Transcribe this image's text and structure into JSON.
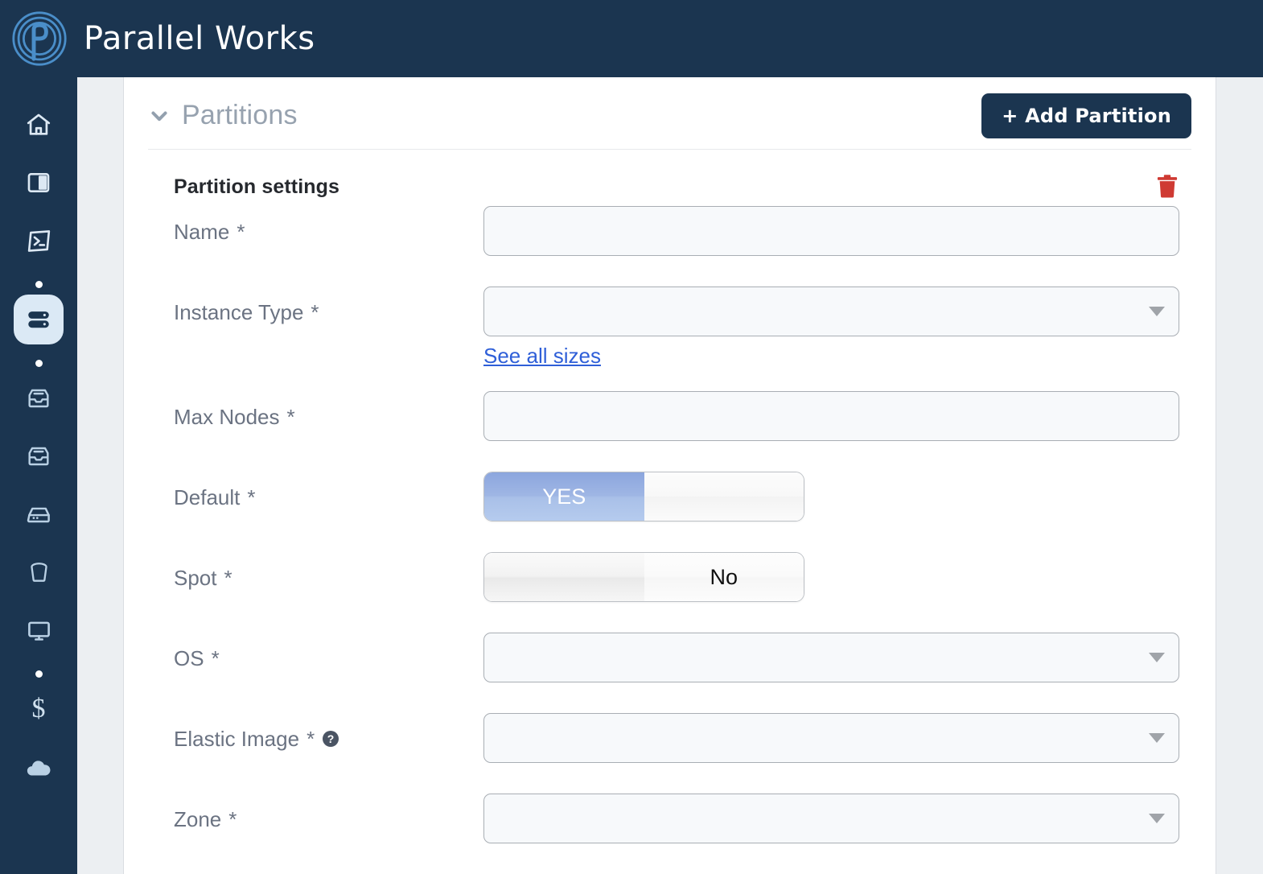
{
  "topbar": {
    "brand_name": "Parallel Works",
    "logo_icon": "parallel-works-logo",
    "bg_color": "#1b3550"
  },
  "sidebar": {
    "items": [
      {
        "icon": "home-icon",
        "name": "home",
        "type": "icon",
        "active": false
      },
      {
        "icon": "panel-icon",
        "name": "panel",
        "type": "icon",
        "active": false
      },
      {
        "icon": "terminal-icon",
        "name": "terminal",
        "type": "icon",
        "active": false
      },
      {
        "icon": "dot-icon",
        "name": "divider-1",
        "type": "dot",
        "active": false
      },
      {
        "icon": "server-icon",
        "name": "clusters",
        "type": "icon",
        "active": true
      },
      {
        "icon": "dot-icon",
        "name": "divider-2",
        "type": "dot",
        "active": false
      },
      {
        "icon": "inbox-icon",
        "name": "inbox-1",
        "type": "icon",
        "active": false
      },
      {
        "icon": "inbox-icon",
        "name": "inbox-2",
        "type": "icon",
        "active": false
      },
      {
        "icon": "harddrive-icon",
        "name": "storage",
        "type": "icon",
        "active": false
      },
      {
        "icon": "bucket-icon",
        "name": "buckets",
        "type": "icon",
        "active": false
      },
      {
        "icon": "monitor-icon",
        "name": "sessions",
        "type": "icon",
        "active": false
      },
      {
        "icon": "dot-icon",
        "name": "divider-3",
        "type": "dot",
        "active": false
      },
      {
        "icon": "dollar-icon",
        "name": "billing",
        "type": "money",
        "active": false,
        "glyph": "$"
      },
      {
        "icon": "cloud-icon",
        "name": "cloud",
        "type": "icon",
        "active": false
      }
    ],
    "active_bg": "#dbe9f5"
  },
  "section": {
    "chevron_icon": "chevron-down-icon",
    "title": "Partitions",
    "add_button_label": "+ Add Partition",
    "add_button_color": "#1b3550"
  },
  "partition": {
    "heading": "Partition settings",
    "delete_icon": "trash-icon",
    "delete_color": "#cf3a33",
    "fields": {
      "name": {
        "label": "Name",
        "required_mark": "*",
        "value": "",
        "placeholder": ""
      },
      "instance_type": {
        "label": "Instance Type",
        "required_mark": "*",
        "value": "",
        "link_label": "See all sizes",
        "link_color": "#2f5fd8"
      },
      "max_nodes": {
        "label": "Max Nodes",
        "required_mark": "*",
        "value": "",
        "placeholder": ""
      },
      "default": {
        "label": "Default",
        "required_mark": "*",
        "left_label": "YES",
        "right_label": "",
        "selected": "YES",
        "active_color": "#a0b8e5"
      },
      "spot": {
        "label": "Spot",
        "required_mark": "*",
        "left_label": "",
        "right_label": "No",
        "selected": "No"
      },
      "os": {
        "label": "OS",
        "required_mark": "*",
        "value": ""
      },
      "elastic_image": {
        "label": "Elastic Image",
        "required_mark": "*",
        "help_icon": "question-circle-icon",
        "value": ""
      },
      "zone": {
        "label": "Zone",
        "required_mark": "*",
        "value": ""
      }
    }
  }
}
